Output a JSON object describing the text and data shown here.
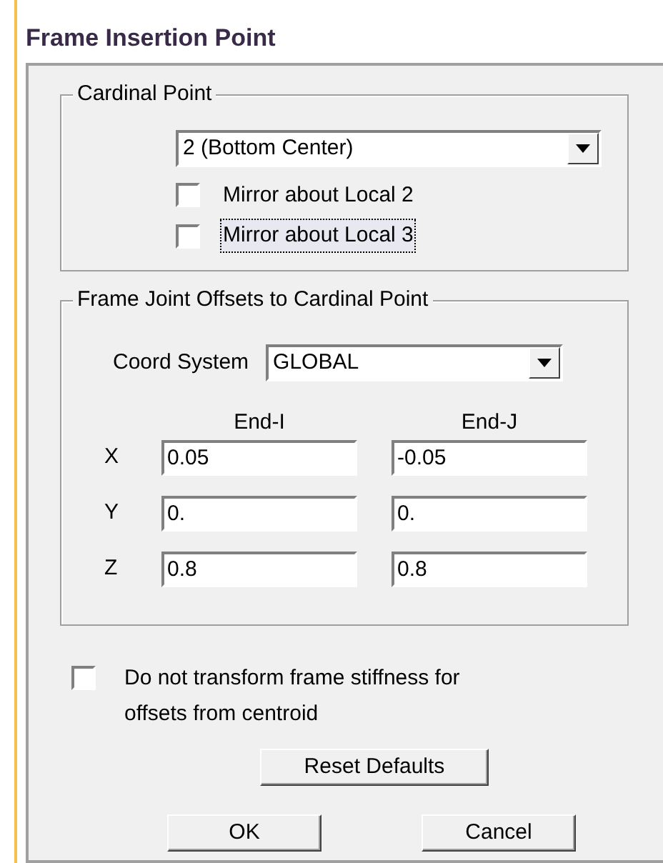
{
  "window": {
    "title": "Frame Insertion Point"
  },
  "cardinal_point": {
    "legend": "Cardinal Point",
    "value": "2 (Bottom Center)",
    "options": [
      {
        "label": "Mirror about Local 2",
        "checked": false,
        "focused": false
      },
      {
        "label": "Mirror about Local 3",
        "checked": false,
        "focused": true
      }
    ]
  },
  "offsets": {
    "legend": "Frame Joint Offsets to Cardinal Point",
    "coord_label": "Coord System",
    "coord_value": "GLOBAL",
    "columns": [
      "End-I",
      "End-J"
    ],
    "rows": [
      {
        "axis": "X",
        "values": [
          "0.05",
          "-0.05"
        ]
      },
      {
        "axis": "Y",
        "values": [
          "0.",
          "0."
        ]
      },
      {
        "axis": "Z",
        "values": [
          "0.8",
          "0.8"
        ]
      }
    ]
  },
  "stiffness": {
    "label": "Do not transform frame stiffness for offsets from centroid",
    "checked": false
  },
  "buttons": {
    "reset": "Reset Defaults",
    "ok": "OK",
    "cancel": "Cancel"
  }
}
